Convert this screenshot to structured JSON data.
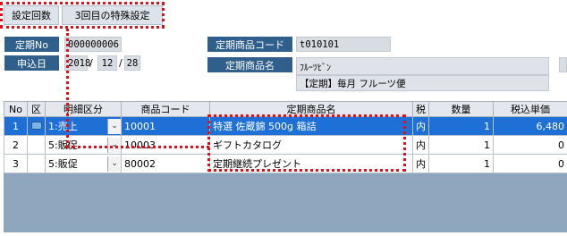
{
  "tabs": [
    {
      "label": "設定回数"
    },
    {
      "label": "3回目の特殊設定"
    }
  ],
  "form": {
    "teiki_no_label": "定期No",
    "teiki_no_value": "000000006",
    "moushikomi_label": "申込日",
    "date_year": "2018",
    "date_month": "12",
    "date_day": "28",
    "date_sep1": "/",
    "date_sep2": "/",
    "product_code_label": "定期商品コード",
    "product_code_value": "t010101",
    "product_name_label": "定期商品名",
    "product_name_kana": "ﾌﾙｰﾂﾋﾞﾝ",
    "product_name_value": "【定期】毎月 フルーツ便"
  },
  "grid": {
    "headers": [
      "No",
      "区",
      "明細区分",
      "商品コード",
      "定期商品名",
      "税",
      "数量",
      "税込単価"
    ],
    "rows": [
      {
        "no": "1",
        "kubun": "1:売上",
        "code": "10001",
        "name": "特選 佐蔵錦 500g 箱詰",
        "tax": "内",
        "qty": "1",
        "price": "6,480",
        "selected": true
      },
      {
        "no": "2",
        "kubun": "5:販促",
        "code": "10003",
        "name": "ギフトカタログ",
        "tax": "内",
        "qty": "1",
        "price": "0",
        "selected": false
      },
      {
        "no": "3",
        "kubun": "5:販促",
        "code": "80002",
        "name": "定期継続プレゼント",
        "tax": "内",
        "qty": "1",
        "price": "0",
        "selected": false
      }
    ]
  },
  "icons": {
    "dropdown_arrow": "chevron-down-icon",
    "row_edit": "row-status-icon"
  },
  "colors": {
    "label_bg": "#2f5f8a",
    "selection": "#1e6fd6",
    "annotation": "#e0101a"
  }
}
